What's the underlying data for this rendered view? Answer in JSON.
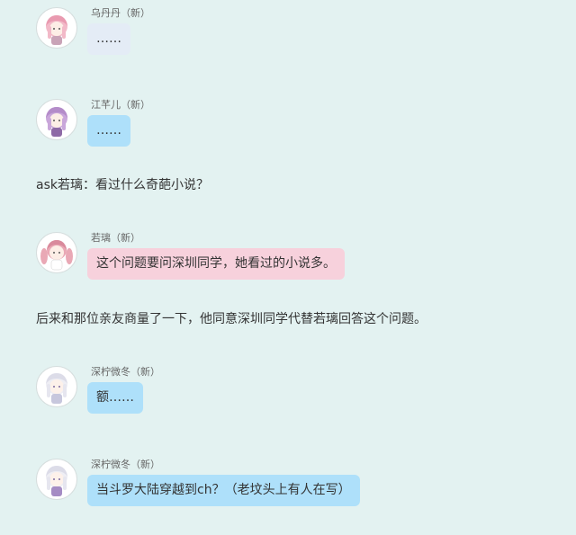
{
  "messages": [
    {
      "sender": "乌丹丹（新）",
      "text": "……",
      "bubble_color": "#e4ecf6",
      "avatar": "pink-hair-girl-avatar"
    },
    {
      "sender": "江芊儿（新）",
      "text": "……",
      "bubble_color": "#aee0fa",
      "avatar": "purple-hair-girl-avatar"
    },
    {
      "sender": "若璃（新）",
      "text": "这个问题要问深圳同学，她看过的小说多。",
      "bubble_color": "#f7d1dc",
      "avatar": "pink-twin-tails-girl-avatar"
    },
    {
      "sender": "深柠微冬（新）",
      "text": "额……",
      "bubble_color": "#aee0fa",
      "avatar": "white-hair-girl-avatar"
    },
    {
      "sender": "深柠微冬（新）",
      "text": "当斗罗大陆穿越到ch？（老坟头上有人在写）",
      "bubble_color": "#aee0fa",
      "avatar": "white-hair-girl-avatar"
    }
  ],
  "narration": [
    "ask若璃：看过什么奇葩小说？",
    "后来和那位亲友商量了一下，他同意深圳同学代替若璃回答这个问题。"
  ],
  "colors": {
    "background": "#e3f2f1",
    "text": "#333333",
    "sender": "#666666"
  }
}
